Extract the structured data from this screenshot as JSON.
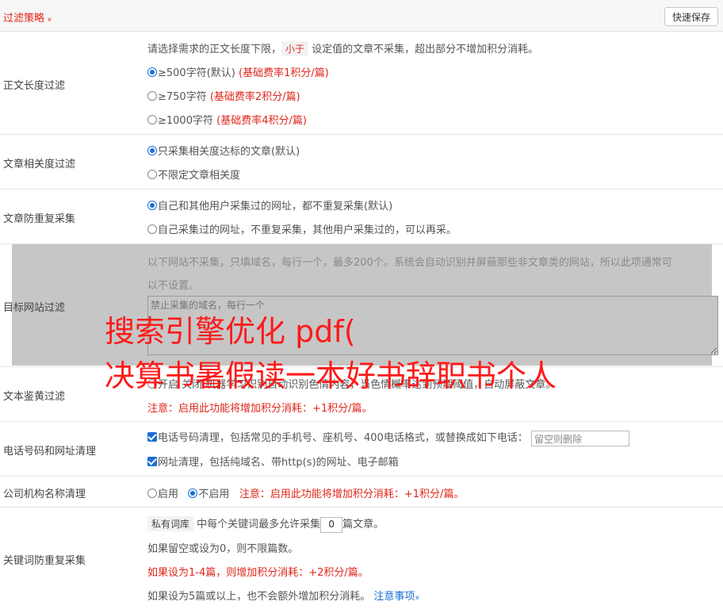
{
  "header": {
    "title": "过滤策略",
    "chevron": "»",
    "save_label": "快速保存"
  },
  "length_filter": {
    "label": "正文长度过滤",
    "desc_pre": "请选择需求的正文长度下限，",
    "desc_tag": "小于",
    "desc_post": "设定值的文章不采集，超出部分不增加积分消耗。",
    "options": [
      {
        "text": "≥500字符(默认)",
        "note": "(基础费率1积分/篇)"
      },
      {
        "text": "≥750字符",
        "note": "(基础费率2积分/篇)"
      },
      {
        "text": "≥1000字符",
        "note": "(基础费率4积分/篇)"
      }
    ]
  },
  "relevance_filter": {
    "label": "文章相关度过滤",
    "options": [
      "只采集相关度达标的文章(默认)",
      "不限定文章相关度"
    ]
  },
  "dup_filter": {
    "label": "文章防重复采集",
    "options": [
      "自己和其他用户采集过的网址，都不重复采集(默认)",
      "自己采集过的网址，不重复采集，其他用户采集过的，可以再采。"
    ]
  },
  "site_filter": {
    "label": "目标网站过滤",
    "desc_line1": "以下网站不采集，只填域名，每行一个，最多200个。系统会自动识别并屏蔽那些非文章类的网站，所以此项通常可",
    "desc_line2": "以不设置。",
    "placeholder": "禁止采集的域名，每行一个"
  },
  "text_check": {
    "label": "文本鉴黄过滤",
    "line": "开启  关闭  机器学习识别自动识别色情内容，当色情概率达到预期阈值，自动屏蔽文章。",
    "note": "注意：启用此功能将增加积分消耗：+1积分/篇。"
  },
  "phone_clean": {
    "label": "电话号码和网址清理",
    "phone_text": "电话号码清理，包括常见的手机号、座机号、400电话格式，或替换成如下电话：",
    "phone_placeholder": "留空则删除",
    "url_text": "网址清理，包括纯域名、带http(s)的网址、电子邮箱"
  },
  "org_clean": {
    "label": "公司机构名称清理",
    "enable": "启用",
    "disable": "不启用",
    "note": "注意：启用此功能将增加积分消耗：+1积分/篇。"
  },
  "keyword_dup": {
    "label": "关键词防重复采集",
    "tag": "私有词库",
    "line1_mid": "中每个关键词最多允许采集",
    "count": "0",
    "line1_end": "篇文章。",
    "line2": "如果留空或设为0，则不限篇数。",
    "line3": "如果设为1-4篇，则增加积分消耗：+2积分/篇。",
    "line4": "如果设为5篇或以上，也不会额外增加积分消耗。",
    "notes_link": "注意事项",
    "notes_chevron": "»"
  },
  "watermark": {
    "line1": "搜索引擎优化 pdf(",
    "line2": "决算书暑假读一本好书辞职书个人"
  },
  "colors": {
    "accent": "#e0261a",
    "link": "#1a6fd3",
    "overlay": "#c6c6c6"
  }
}
